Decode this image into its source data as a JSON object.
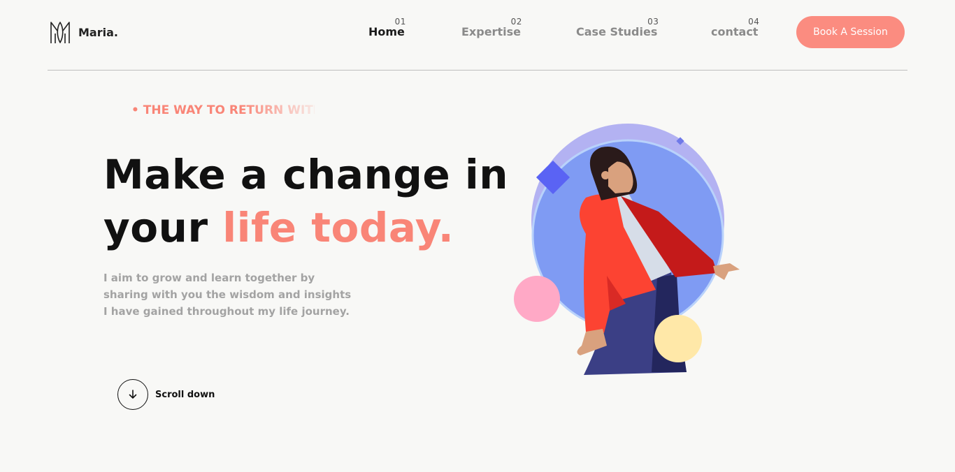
{
  "brand": {
    "name": "Maria.",
    "logo_icon": "m-monogram-icon"
  },
  "nav": [
    {
      "num": "01",
      "label": "Home",
      "active": true
    },
    {
      "num": "02",
      "label": "Expertise",
      "active": false
    },
    {
      "num": "03",
      "label": "Case Studies",
      "active": false
    },
    {
      "num": "04",
      "label": "contact",
      "active": false
    }
  ],
  "cta": {
    "label": "Book A Session"
  },
  "hero": {
    "marquee": "• THE WAY TO RETURN WITH",
    "title_line1": "Make a change in",
    "title_line2_prefix": "your ",
    "title_line2_accent": "life today.",
    "description": "I aim to grow and learn together by sharing with you the wisdom and insights I have gained throughout my life journey."
  },
  "scroll": {
    "label": "Scroll down",
    "icon": "arrow-down-icon"
  },
  "colors": {
    "accent": "#f98577",
    "button": "#fb8c80",
    "background": "#f8f8f6"
  }
}
